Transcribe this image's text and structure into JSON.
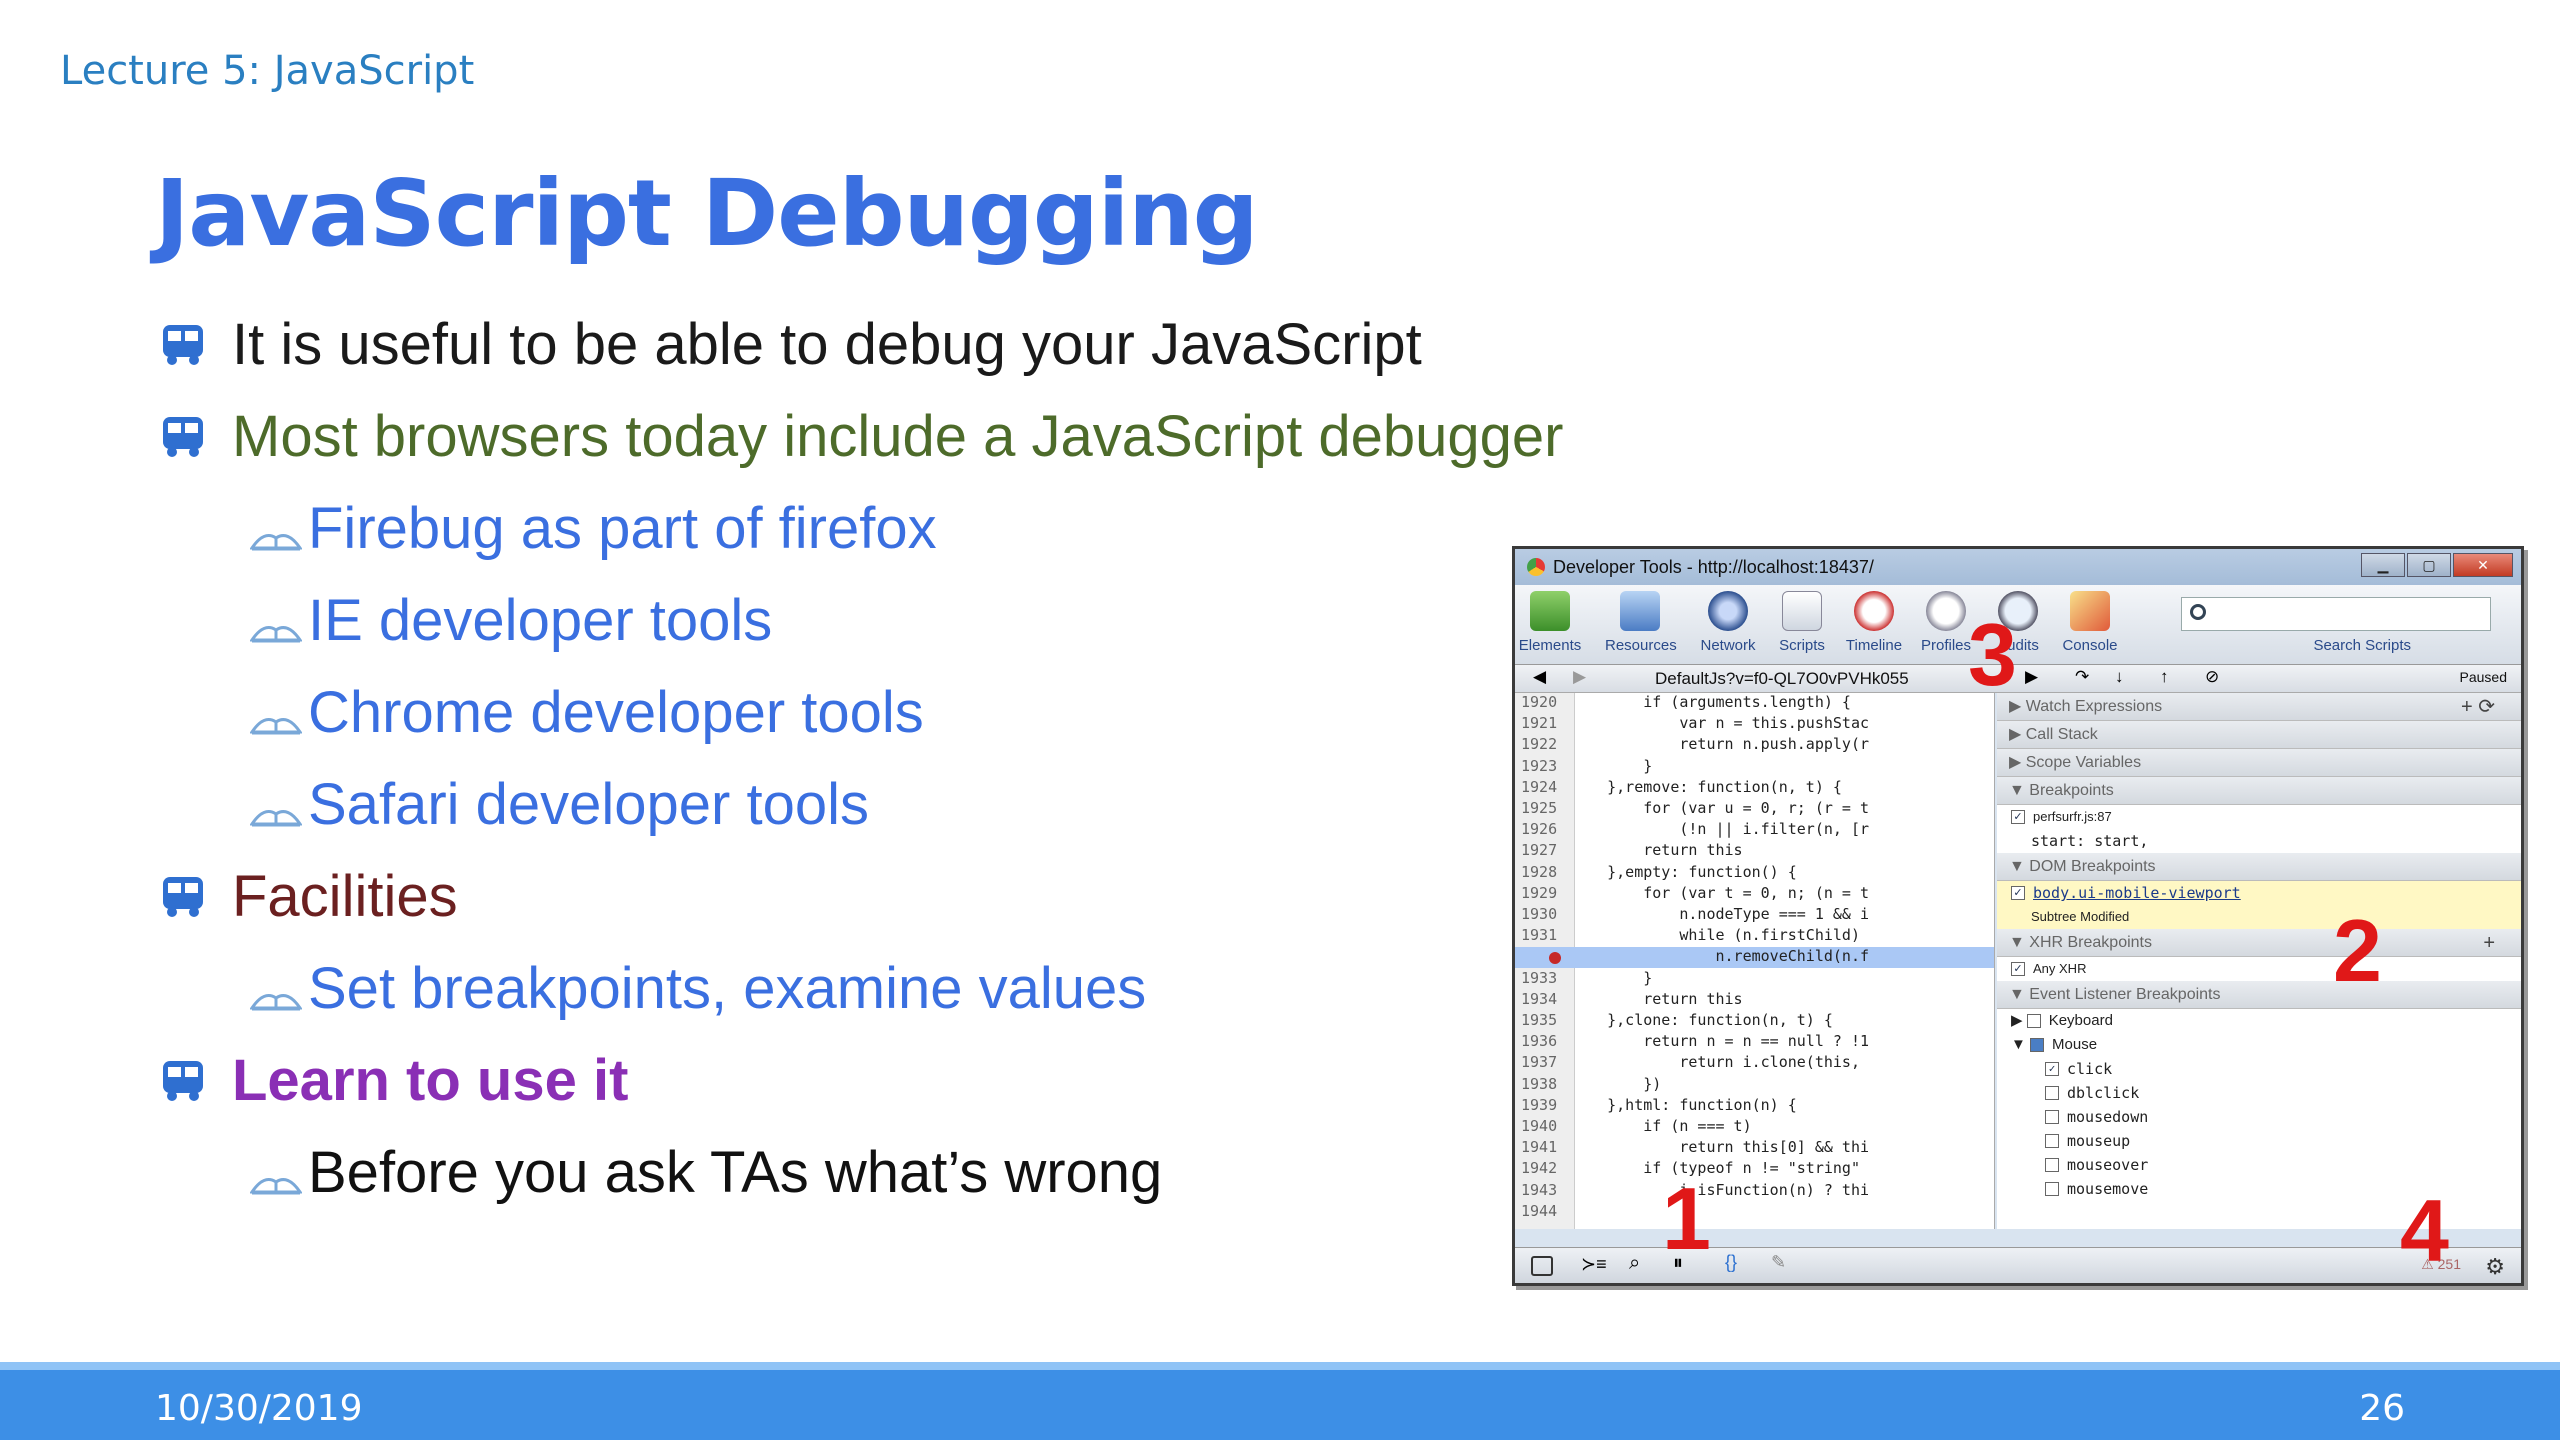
{
  "header": {
    "lecture": "Lecture 5: JavaScript"
  },
  "title": "JavaScript Debugging",
  "bullets": [
    {
      "text": "It is useful to be able to debug your JavaScript",
      "level": 1,
      "color": "#1a1a1a"
    },
    {
      "text": "Most browsers today include a JavaScript debugger",
      "level": 1,
      "color": "#4d6b2a"
    },
    {
      "text": "Firebug as part of firefox",
      "level": 2,
      "color": "#3a6fe0"
    },
    {
      "text": "IE developer tools",
      "level": 2,
      "color": "#3a6fe0"
    },
    {
      "text": "Chrome developer tools",
      "level": 2,
      "color": "#3a6fe0"
    },
    {
      "text": "Safari developer tools",
      "level": 2,
      "color": "#3a6fe0"
    },
    {
      "text": "Facilities",
      "level": 1,
      "color": "#6b2020"
    },
    {
      "text": "Set breakpoints, examine values",
      "level": 2,
      "color": "#3a6fe0"
    },
    {
      "text": "Learn to use it",
      "level": 1,
      "color": "#8a2fb5"
    },
    {
      "text": "Before you ask TAs what’s wrong",
      "level": 2,
      "color": "#111111"
    }
  ],
  "devtools": {
    "window_title": "Developer Tools - http://localhost:18437/",
    "tools": [
      "Elements",
      "Resources",
      "Network",
      "Scripts",
      "Timeline",
      "Profiles",
      "Audits",
      "Console"
    ],
    "search_label": "Search Scripts",
    "file": "DefaultJs?v=f0-QL7O0vPVHk055",
    "paused": "Paused",
    "code": [
      {
        "ln": "1920",
        "src": "        if (arguments.length) {"
      },
      {
        "ln": "1921",
        "src": "            var n = this.pushStac"
      },
      {
        "ln": "1922",
        "src": "            return n.push.apply(r"
      },
      {
        "ln": "1923",
        "src": "        }"
      },
      {
        "ln": "1924",
        "src": "    },remove: function(n, t) {"
      },
      {
        "ln": "1925",
        "src": "        for (var u = 0, r; (r = t"
      },
      {
        "ln": "1926",
        "src": "            (!n || i.filter(n, [r"
      },
      {
        "ln": "1927",
        "src": "        return this"
      },
      {
        "ln": "1928",
        "src": "    },empty: function() {"
      },
      {
        "ln": "1929",
        "src": "        for (var t = 0, n; (n = t"
      },
      {
        "ln": "1930",
        "src": "            n.nodeType === 1 && i"
      },
      {
        "ln": "1931",
        "src": "            while (n.firstChild)"
      },
      {
        "ln": "",
        "src": "                n.removeChild(n.f"
      },
      {
        "ln": "1933",
        "src": "        }"
      },
      {
        "ln": "1934",
        "src": "        return this"
      },
      {
        "ln": "1935",
        "src": "    },clone: function(n, t) {"
      },
      {
        "ln": "1936",
        "src": "        return n = n == null ? !1"
      },
      {
        "ln": "1937",
        "src": "            return i.clone(this,"
      },
      {
        "ln": "1938",
        "src": "        })"
      },
      {
        "ln": "1939",
        "src": "    },html: function(n) {"
      },
      {
        "ln": "1940",
        "src": "        if (n === t)"
      },
      {
        "ln": "1941",
        "src": "            return this[0] && thi"
      },
      {
        "ln": "1942",
        "src": "        if (typeof n != \"string\""
      },
      {
        "ln": "1943",
        "src": "            i.isFunction(n) ? thi"
      },
      {
        "ln": "1944",
        "src": ""
      }
    ],
    "sections": {
      "watch": "Watch Expressions",
      "callstack": "Call Stack",
      "scope": "Scope Variables",
      "breakpoints": "Breakpoints",
      "bp_file": "perfsurfr.js:87",
      "bp_code": "start: start,",
      "dom": "DOM Breakpoints",
      "dom_item": "body.ui-mobile-viewport",
      "dom_sub": "Subtree Modified",
      "xhr": "XHR Breakpoints",
      "xhr_item": "Any XHR",
      "event": "Event Listener Breakpoints",
      "keyboard": "Keyboard",
      "mouse": "Mouse",
      "events": [
        "click",
        "dblclick",
        "mousedown",
        "mouseup",
        "mouseover",
        "mousemove"
      ]
    },
    "status_err": "⚠ 251"
  },
  "annotations": [
    "1",
    "2",
    "3",
    "4"
  ],
  "footer": {
    "date": "10/30/2019",
    "page": "26"
  }
}
